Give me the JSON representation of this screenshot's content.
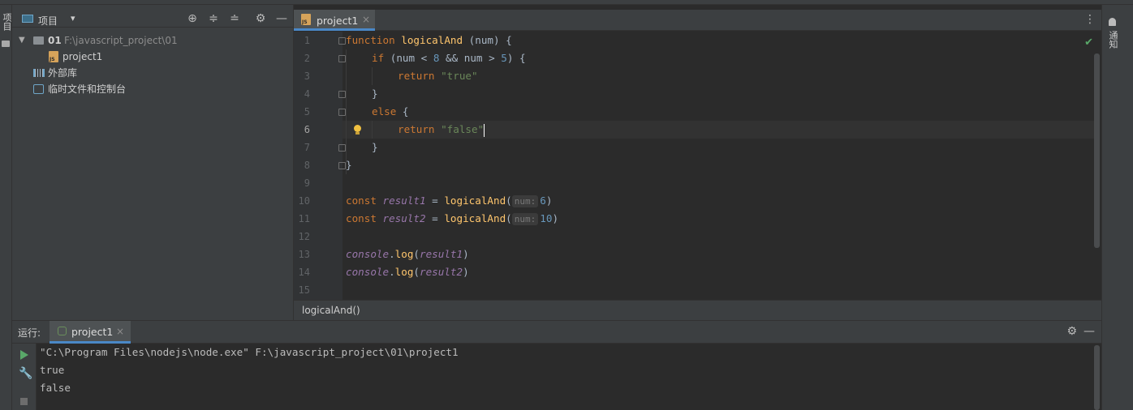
{
  "project_panel": {
    "title": "项目",
    "tree": [
      {
        "name": "01",
        "path": "F:\\javascript_project\\01"
      },
      {
        "name": "project1"
      },
      {
        "name": "外部库"
      },
      {
        "name": "临时文件和控制台"
      }
    ]
  },
  "left_stripe": {
    "label": "项目"
  },
  "right_stripe": {
    "label": "通知"
  },
  "editor": {
    "tab": "project1",
    "breadcrumb": "logicalAnd()",
    "current_line": 6,
    "line_numbers": [
      "1",
      "2",
      "3",
      "4",
      "5",
      "6",
      "7",
      "8",
      "9",
      "10",
      "11",
      "12",
      "13",
      "14",
      "15"
    ]
  },
  "code": {
    "l1": {
      "kw": "function",
      "fn": "logicalAnd",
      "rest": " (num) {"
    },
    "l2": {
      "kw": "if",
      "rest1": " (num < ",
      "n1": "8",
      "rest2": " && num > ",
      "n2": "5",
      "rest3": ") {"
    },
    "l3": {
      "kw": "return",
      "str": "\"true\""
    },
    "l4": {
      "text": "}"
    },
    "l5": {
      "kw": "else",
      "rest": " {"
    },
    "l6": {
      "kw": "return",
      "str": "\"false\""
    },
    "l7": {
      "text": "}"
    },
    "l8": {
      "text": "}"
    },
    "l10": {
      "kw": "const",
      "var": "result1",
      "eq": " = ",
      "fn": "logicalAnd",
      "open": "(",
      "hint": "num:",
      "arg": "6",
      "close": ")"
    },
    "l11": {
      "kw": "const",
      "var": "result2",
      "eq": " = ",
      "fn": "logicalAnd",
      "open": "(",
      "hint": "num:",
      "arg": "10",
      "close": ")"
    },
    "l13": {
      "obj": "console",
      "dot": ".",
      "fn": "log",
      "open": "(",
      "var": "result1",
      "close": ")"
    },
    "l14": {
      "obj": "console",
      "dot": ".",
      "fn": "log",
      "open": "(",
      "var": "result2",
      "close": ")"
    }
  },
  "run": {
    "label": "运行:",
    "tab": "project1",
    "output": [
      "\"C:\\Program Files\\nodejs\\node.exe\" F:\\javascript_project\\01\\project1",
      "true",
      "false"
    ]
  },
  "colors": {
    "keyword": "#cc7832",
    "function": "#ffc66d",
    "string": "#6a8759",
    "number": "#6897bb",
    "accent": "#4a88c7",
    "success": "#59a869"
  }
}
